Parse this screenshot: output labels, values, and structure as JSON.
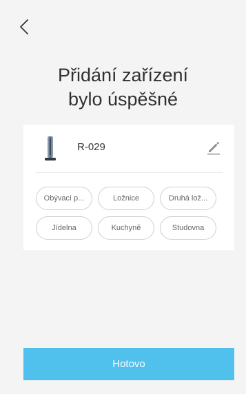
{
  "nav": {
    "back_icon": "chevron-left-icon"
  },
  "header": {
    "title_line1": "Přidání zařízení",
    "title_line2": "bylo úspěšné"
  },
  "device": {
    "name": "R-029",
    "image_icon": "tower-fan-icon",
    "edit_icon": "pencil-icon"
  },
  "rooms": [
    {
      "label": "Obývací p..."
    },
    {
      "label": "Ložnice"
    },
    {
      "label": "Druhá lož..."
    },
    {
      "label": "Jídelna"
    },
    {
      "label": "Kuchyně"
    },
    {
      "label": "Studovna"
    }
  ],
  "footer": {
    "done_label": "Hotovo"
  },
  "colors": {
    "background": "#f4f4f4",
    "card": "#ffffff",
    "accent": "#4fc1ec",
    "chip_border": "#cfcfcf"
  }
}
